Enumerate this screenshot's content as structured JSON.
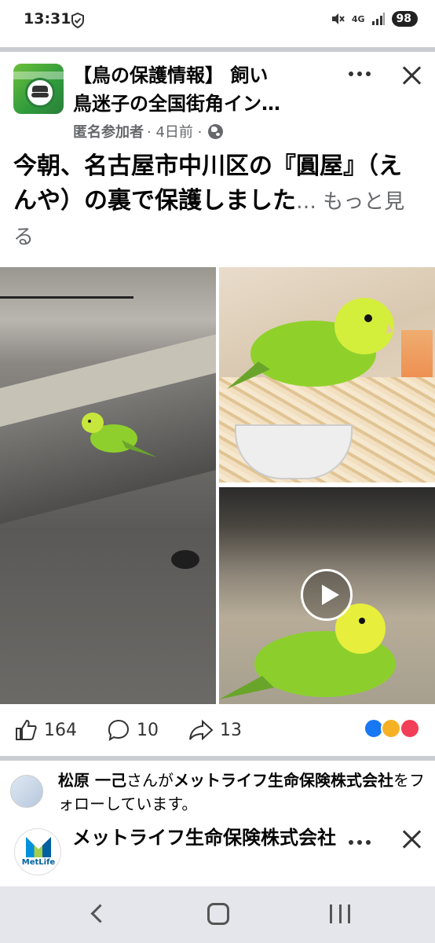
{
  "status_bar": {
    "time": "13:31",
    "network": "4G",
    "battery": "98"
  },
  "post": {
    "group_title_line1": "【鳥の保護情報】 飼い",
    "group_title_line2": "鳥迷子の全国街角イン…",
    "author": "匿名参加者",
    "time": "· 4日前 ·",
    "text": "今朝、名古屋市中川区の『圓屋』（えんや）の裏で保護しました",
    "see_more": "… もっと見る"
  },
  "actions": {
    "likes": "164",
    "comments": "10",
    "shares": "13"
  },
  "colors": {
    "like": "#1877f2",
    "love": "#f33e58",
    "care": "#f7b125",
    "divider": "#c9ccd1",
    "secondary_text": "#65676b"
  },
  "follow": {
    "name": "松原 一己",
    "mid": "さんが",
    "org": "メットライフ生命保険株式会社",
    "suffix": "をフォローしています。"
  },
  "ad": {
    "title": "メットライフ生命保険株式会社",
    "brand": "MetLife"
  }
}
